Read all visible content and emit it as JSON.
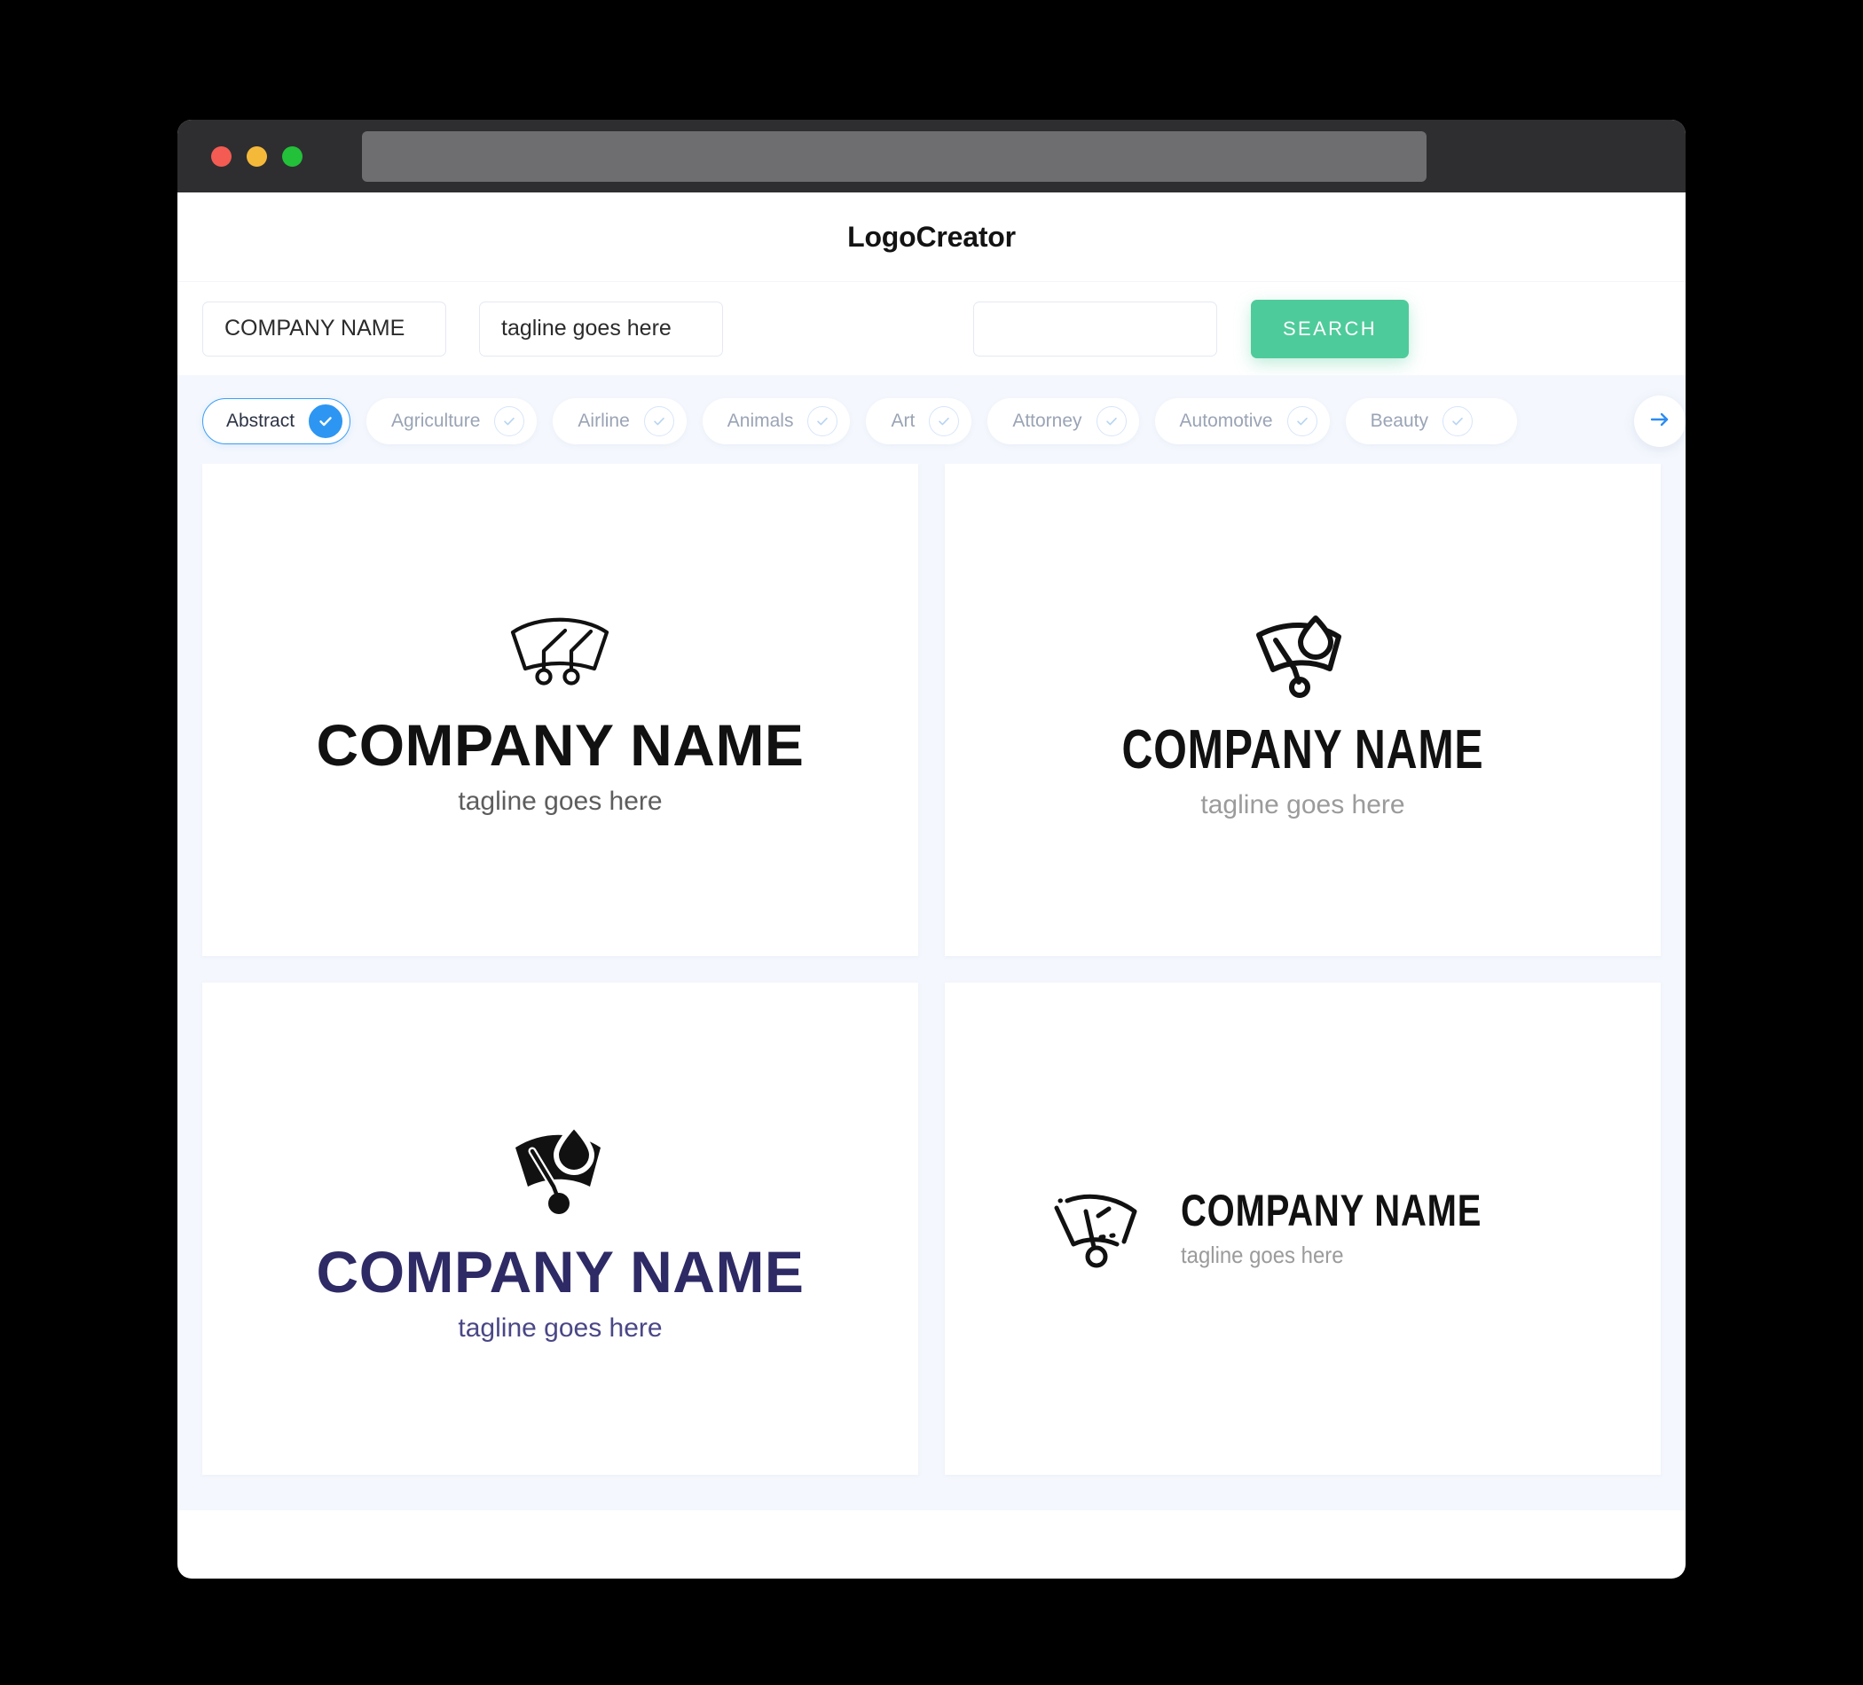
{
  "browser": {
    "traffic_lights": [
      "close",
      "minimize",
      "maximize"
    ],
    "url_value": "",
    "colors": {
      "titlebar": "#2e2e30",
      "urlbar": "#6e6e70",
      "red": "#f45b52",
      "yellow": "#f5b93a",
      "green": "#23c03a"
    }
  },
  "app": {
    "title": "LogoCreator",
    "background": "#f4f7fd",
    "accent_green": "#4ecb9a",
    "accent_blue": "#2d96f2"
  },
  "search": {
    "company_value": "COMPANY NAME",
    "company_placeholder": "COMPANY NAME",
    "tagline_value": "tagline goes here",
    "tagline_placeholder": "tagline goes here",
    "extra_value": "",
    "extra_placeholder": "",
    "button_label": "SEARCH"
  },
  "categories": {
    "items": [
      {
        "label": "Abstract",
        "selected": true
      },
      {
        "label": "Agriculture",
        "selected": false
      },
      {
        "label": "Airline",
        "selected": false
      },
      {
        "label": "Animals",
        "selected": false
      },
      {
        "label": "Art",
        "selected": false
      },
      {
        "label": "Attorney",
        "selected": false
      },
      {
        "label": "Automotive",
        "selected": false
      },
      {
        "label": "Beauty",
        "selected": false
      }
    ],
    "next_button": "next-arrow"
  },
  "logos": [
    {
      "icon": "windshield-two-wipers-outline",
      "name": "COMPANY NAME",
      "tagline": "tagline goes here",
      "layout": "vertical",
      "name_color": "#111111",
      "tagline_color": "#5d5d5d"
    },
    {
      "icon": "windshield-droplet-wiper-outline",
      "name": "COMPANY NAME",
      "tagline": "tagline goes here",
      "layout": "vertical-condensed",
      "name_color": "#111111",
      "tagline_color": "#9b9b9b"
    },
    {
      "icon": "windshield-droplet-wiper-solid",
      "name": "COMPANY NAME",
      "tagline": "tagline goes here",
      "layout": "vertical",
      "name_color": "#2e2a65",
      "tagline_color": "#4a4786"
    },
    {
      "icon": "windshield-wiper-spray-outline",
      "name": "COMPANY NAME",
      "tagline": "tagline goes here",
      "layout": "horizontal",
      "name_color": "#111111",
      "tagline_color": "#9b9b9b"
    }
  ]
}
